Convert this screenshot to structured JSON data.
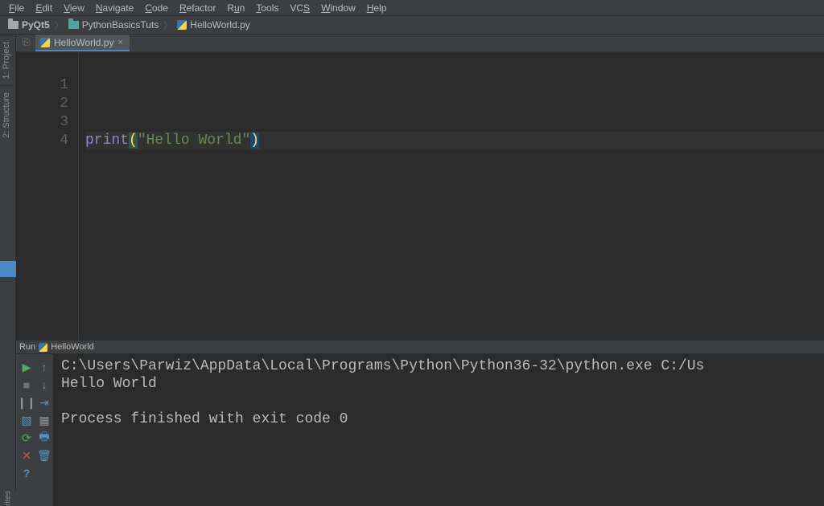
{
  "menu": [
    "File",
    "Edit",
    "View",
    "Navigate",
    "Code",
    "Refactor",
    "Run",
    "Tools",
    "VCS",
    "Window",
    "Help"
  ],
  "breadcrumb": {
    "project": "PyQt5",
    "folder": "PythonBasicsTuts",
    "file": "HelloWorld.py"
  },
  "rail": {
    "project": "1: Project",
    "structure": "2: Structure",
    "bottom": "rites"
  },
  "editor": {
    "tab_label": "HelloWorld.py",
    "line_numbers": [
      "1",
      "2",
      "3",
      "4"
    ],
    "code_line4": {
      "fn": "print",
      "open": "(",
      "str": "\"Hello World\"",
      "close": ")"
    }
  },
  "run": {
    "title": "Run",
    "config": "HelloWorld",
    "output": "C:\\Users\\Parwiz\\AppData\\Local\\Programs\\Python\\Python36-32\\python.exe C:/Us\nHello World\n\nProcess finished with exit code 0"
  }
}
